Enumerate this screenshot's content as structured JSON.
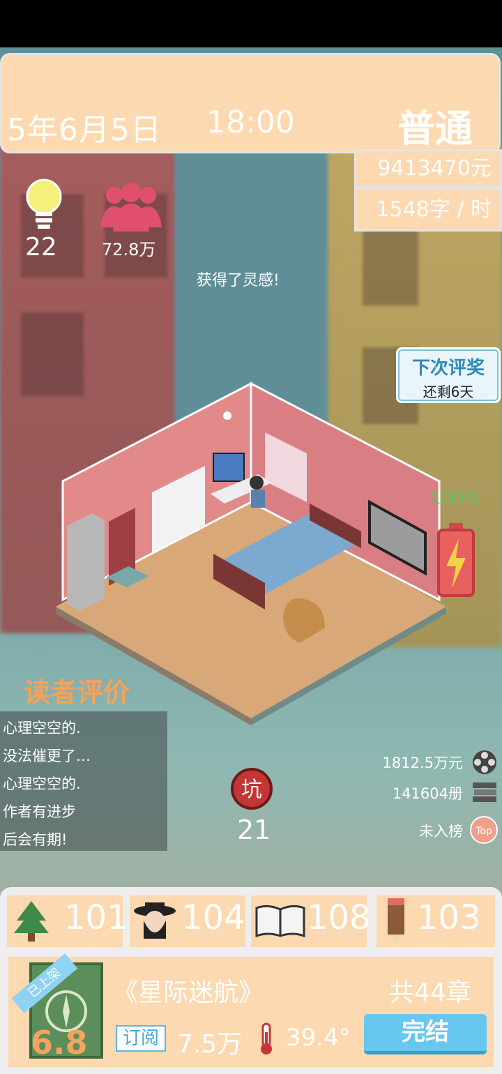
{
  "header": {
    "date": "5年6月5日",
    "time": "18:00",
    "difficulty": "普通"
  },
  "stats": {
    "money": "9413470元",
    "speed": "1548字 / 时",
    "inspiration": "22",
    "fans": "72.8万"
  },
  "toast": "获得了灵感!",
  "award": {
    "title": "下次评奖",
    "days": "还剩6天"
  },
  "battery": {
    "percent_label": "100%",
    "level": 1.0
  },
  "reviews": {
    "title": "读者评价",
    "lines": [
      "心理空空的.",
      "没法催更了…",
      "心理空空的.",
      "作者有进步",
      "后会有期!"
    ]
  },
  "pit": {
    "icon_label": "坑",
    "count": "21"
  },
  "sales": {
    "income": "1812.5万元",
    "copies": "141604册",
    "rank": "未入榜",
    "rank_icon_label": "Top"
  },
  "attributes": [
    {
      "icon": "tree-icon",
      "value": "101"
    },
    {
      "icon": "character-icon",
      "value": "104"
    },
    {
      "icon": "open-book-icon",
      "value": "108"
    },
    {
      "icon": "pencil-icon",
      "value": "103"
    }
  ],
  "book": {
    "ribbon": "已上架",
    "score": "6.8",
    "title": "《星际迷航》",
    "chapters": "共44章",
    "sub_tag": "订阅",
    "subscriptions": "7.5万",
    "heat": "39.4°",
    "finish_label": "完结"
  },
  "colors": {
    "panel": "#fcd9b0",
    "accent_blue": "#68c7ee",
    "review_title": "#f5a259",
    "battery_green": "#5cc55c"
  }
}
